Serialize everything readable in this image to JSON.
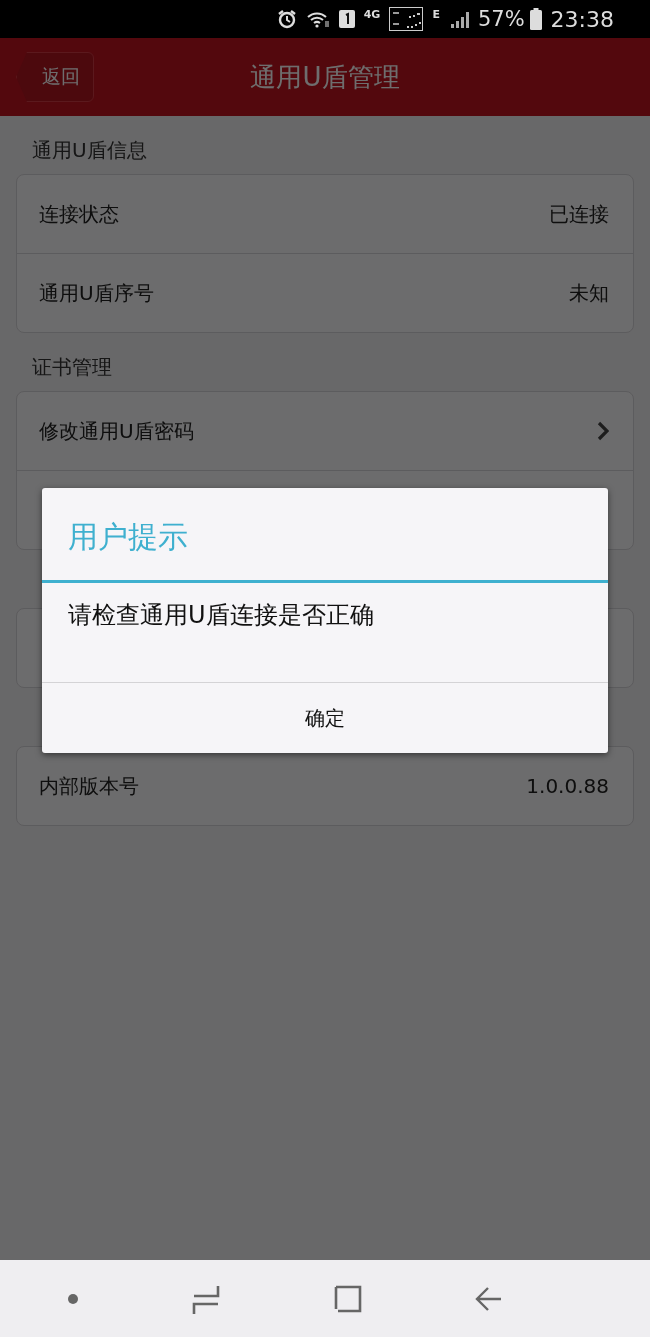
{
  "status_bar": {
    "network_4g": "4G",
    "network_e": "E",
    "battery": "57%",
    "time": "23:38"
  },
  "header": {
    "back": "返回",
    "title": "通用U盾管理"
  },
  "sections": [
    {
      "title": "通用U盾信息",
      "rows": [
        {
          "kind": "value",
          "label": "连接状态",
          "value": "已连接"
        },
        {
          "kind": "value",
          "label": "通用U盾序号",
          "value": "未知"
        }
      ]
    },
    {
      "title": "证书管理",
      "rows": [
        {
          "kind": "link",
          "label": "修改通用U盾密码"
        },
        {
          "kind": "covered"
        }
      ]
    },
    {
      "rows": [
        {
          "kind": "covered"
        }
      ]
    },
    {
      "rows": [
        {
          "kind": "value",
          "label": "内部版本号",
          "value": "1.0.0.88"
        }
      ]
    }
  ],
  "dialog": {
    "title": "用户提示",
    "message": "请检查通用U盾连接是否正确",
    "button": "确定"
  }
}
